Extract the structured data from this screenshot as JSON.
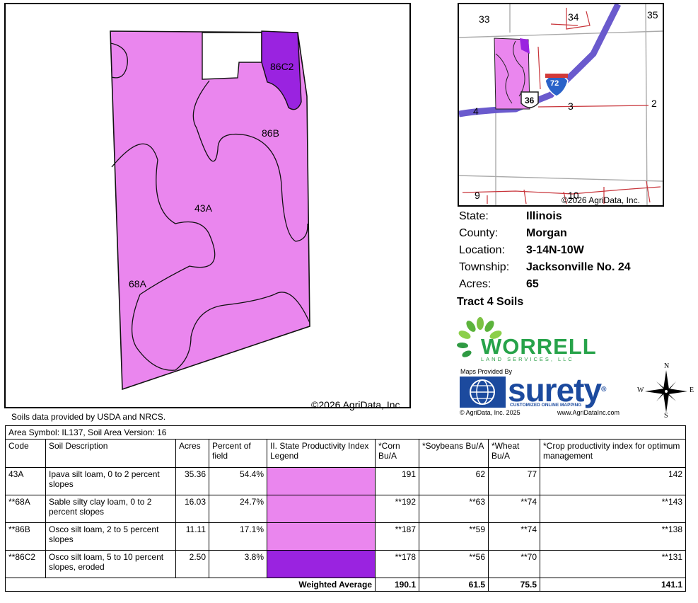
{
  "main_map": {
    "labels": [
      {
        "id": "86C2",
        "text": "86C2"
      },
      {
        "id": "86B",
        "text": "86B"
      },
      {
        "id": "43A",
        "text": "43A"
      },
      {
        "id": "68A",
        "text": "68A"
      }
    ],
    "copyright": "©2026 AgriData, Inc.",
    "colors": {
      "light": "#ea86ee",
      "dark": "#9a23e0"
    }
  },
  "inset_map": {
    "section_labels": [
      "33",
      "34",
      "35",
      "2",
      "3",
      "4",
      "9",
      "10"
    ],
    "route_labels": {
      "us": "36",
      "interstate": "72"
    },
    "copyright": "©2026 AgriData, Inc."
  },
  "info": [
    {
      "label": "State:",
      "value": "Illinois"
    },
    {
      "label": "County:",
      "value": "Morgan"
    },
    {
      "label": "Location:",
      "value": "3-14N-10W"
    },
    {
      "label": "Township:",
      "value": "Jacksonville No. 24"
    },
    {
      "label": "Acres:",
      "value": "65"
    }
  ],
  "tract_title": "Tract 4 Soils",
  "worrell": {
    "name": "WORRELL",
    "sub": "LAND SERVICES, LLC"
  },
  "surety": {
    "caption": "Maps Provided By",
    "word": "surety",
    "registered": "®",
    "tagline": "CUSTOMIZED ONLINE MAPPING",
    "agri_left": "© AgriData, Inc. 2025",
    "agri_right": "www.AgriDataInc.com"
  },
  "compass": {
    "n": "N",
    "e": "E",
    "s": "S",
    "w": "W"
  },
  "source_note": "Soils data provided by USDA and NRCS.",
  "table": {
    "area_header": "Area Symbol: IL137, Soil Area Version: 16",
    "columns": [
      "Code",
      "Soil Description",
      "Acres",
      "Percent of field",
      "II. State Productivity Index Legend",
      "*Corn Bu/A",
      "*Soybeans Bu/A",
      "*Wheat Bu/A",
      "*Crop productivity index for optimum management"
    ],
    "rows": [
      {
        "code": "43A",
        "description": "Ipava silt loam, 0 to 2 percent slopes",
        "acres": "35.36",
        "percent": "54.4%",
        "color": "#ea86ee",
        "corn": "191",
        "soybeans": "62",
        "wheat": "77",
        "cpi": "142"
      },
      {
        "code": "**68A",
        "description": "Sable silty clay loam, 0 to 2 percent slopes",
        "acres": "16.03",
        "percent": "24.7%",
        "color": "#ea86ee",
        "corn": "**192",
        "soybeans": "**63",
        "wheat": "**74",
        "cpi": "**143"
      },
      {
        "code": "**86B",
        "description": "Osco silt loam, 2 to 5 percent slopes",
        "acres": "11.11",
        "percent": "17.1%",
        "color": "#ea86ee",
        "corn": "**187",
        "soybeans": "**59",
        "wheat": "**74",
        "cpi": "**138"
      },
      {
        "code": "**86C2",
        "description": "Osco silt loam, 5 to 10 percent slopes, eroded",
        "acres": "2.50",
        "percent": "3.8%",
        "color": "#9a23e0",
        "corn": "**178",
        "soybeans": "**56",
        "wheat": "**70",
        "cpi": "**131"
      }
    ],
    "weighted": {
      "label": "Weighted Average",
      "corn": "190.1",
      "soybeans": "61.5",
      "wheat": "75.5",
      "cpi": "141.1"
    }
  }
}
